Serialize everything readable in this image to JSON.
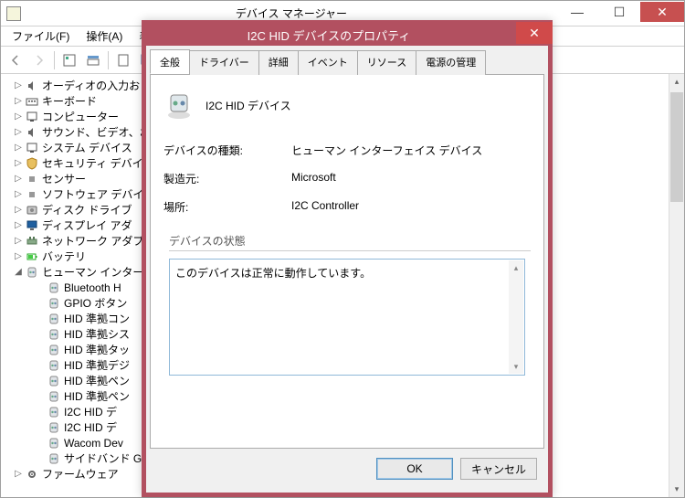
{
  "main": {
    "title": "デバイス マネージャー",
    "menu": {
      "file": "ファイル(F)",
      "action": "操作(A)",
      "view_partial": "表"
    }
  },
  "tree": [
    {
      "lvl": 1,
      "exp": "▷",
      "icon": "speaker",
      "label": "オーディオの入力お"
    },
    {
      "lvl": 1,
      "exp": "▷",
      "icon": "keyboard",
      "label": "キーボード"
    },
    {
      "lvl": 1,
      "exp": "▷",
      "icon": "pc",
      "label": "コンピューター"
    },
    {
      "lvl": 1,
      "exp": "▷",
      "icon": "speaker",
      "label": "サウンド、ビデオ、お"
    },
    {
      "lvl": 1,
      "exp": "▷",
      "icon": "pc",
      "label": "システム デバイス"
    },
    {
      "lvl": 1,
      "exp": "▷",
      "icon": "shield",
      "label": "セキュリティ デバイ"
    },
    {
      "lvl": 1,
      "exp": "▷",
      "icon": "sensor",
      "label": "センサー"
    },
    {
      "lvl": 1,
      "exp": "▷",
      "icon": "sensor",
      "label": "ソフトウェア デバイ"
    },
    {
      "lvl": 1,
      "exp": "▷",
      "icon": "disk",
      "label": "ディスク ドライブ"
    },
    {
      "lvl": 1,
      "exp": "▷",
      "icon": "display",
      "label": "ディスプレイ アダ"
    },
    {
      "lvl": 1,
      "exp": "▷",
      "icon": "net",
      "label": "ネットワーク アダプ"
    },
    {
      "lvl": 1,
      "exp": "▷",
      "icon": "batt",
      "label": "バッテリ"
    },
    {
      "lvl": 1,
      "exp": "◢",
      "icon": "hid",
      "label": "ヒューマン インター"
    },
    {
      "lvl": 2,
      "exp": "",
      "icon": "hid",
      "label": "Bluetooth H"
    },
    {
      "lvl": 2,
      "exp": "",
      "icon": "hid",
      "label": "GPIO ボタン"
    },
    {
      "lvl": 2,
      "exp": "",
      "icon": "hid",
      "label": "HID 準拠コン"
    },
    {
      "lvl": 2,
      "exp": "",
      "icon": "hid",
      "label": "HID 準拠シス"
    },
    {
      "lvl": 2,
      "exp": "",
      "icon": "hid",
      "label": "HID 準拠タッ"
    },
    {
      "lvl": 2,
      "exp": "",
      "icon": "hid",
      "label": "HID 準拠デジ"
    },
    {
      "lvl": 2,
      "exp": "",
      "icon": "hid",
      "label": "HID 準拠ペン"
    },
    {
      "lvl": 2,
      "exp": "",
      "icon": "hid",
      "label": "HID 準拠ペン"
    },
    {
      "lvl": 2,
      "exp": "",
      "icon": "hid",
      "label": "I2C HID デ"
    },
    {
      "lvl": 2,
      "exp": "",
      "icon": "hid",
      "label": "I2C HID デ"
    },
    {
      "lvl": 2,
      "exp": "",
      "icon": "hid",
      "label": "Wacom Dev"
    },
    {
      "lvl": 2,
      "exp": "",
      "icon": "hid",
      "label": "サイドバンド G"
    },
    {
      "lvl": 1,
      "exp": "▷",
      "icon": "gear",
      "label": "ファームウェア"
    }
  ],
  "dialog": {
    "title": "I2C HID デバイスのプロパティ",
    "tabs": [
      "全般",
      "ドライバー",
      "詳細",
      "イベント",
      "リソース",
      "電源の管理"
    ],
    "active_tab": 0,
    "device_name": "I2C HID デバイス",
    "props": {
      "type_label": "デバイスの種類:",
      "type_value": "ヒューマン インターフェイス デバイス",
      "mfr_label": "製造元:",
      "mfr_value": "Microsoft",
      "loc_label": "場所:",
      "loc_value": "I2C Controller"
    },
    "status_label": "デバイスの状態",
    "status_text": "このデバイスは正常に動作しています。",
    "ok": "OK",
    "cancel": "キャンセル"
  }
}
